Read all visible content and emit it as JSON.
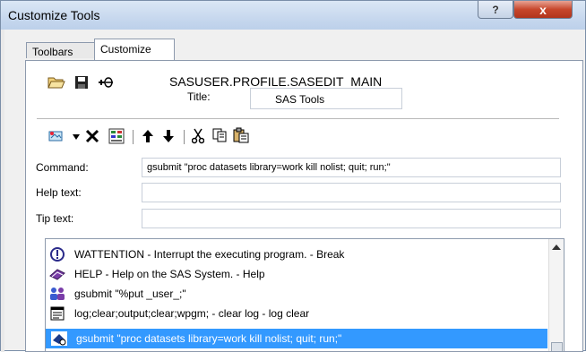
{
  "window": {
    "title": "Customize Tools",
    "help_label": "?",
    "close_label": "x"
  },
  "tabs": [
    {
      "label": "Toolbars"
    },
    {
      "label": "Customize"
    }
  ],
  "customize": {
    "path": "SASUSER.PROFILE.SASEDIT_MAIN",
    "title_label": "Title:",
    "title_value": "SAS Tools",
    "command_label": "Command:",
    "command_value": "gsubmit \"proc datasets library=work kill nolist; quit; run;\"",
    "help_label": "Help text:",
    "help_value": "",
    "tip_label": "Tip text:",
    "tip_value": ""
  },
  "tools_list": {
    "items": [
      {
        "icon": "warning-icon",
        "text": "WATTENTION - Interrupt the executing program. - Break"
      },
      {
        "icon": "help-book-icon",
        "text": "HELP - Help on the SAS System. - Help"
      },
      {
        "icon": "users-icon",
        "text": "gsubmit \"%put _user_;\""
      },
      {
        "icon": "document-icon",
        "text": "log;clear;output;clear;wpgm; - clear log - log clear"
      },
      {
        "icon": "run-icon",
        "text": "gsubmit \"proc datasets library=work kill nolist; quit; run;\"",
        "selected": true
      }
    ]
  },
  "colors": {
    "selection": "#3399ff",
    "title_gradient_top": "#dbe7f5",
    "close_red": "#c7472c"
  }
}
